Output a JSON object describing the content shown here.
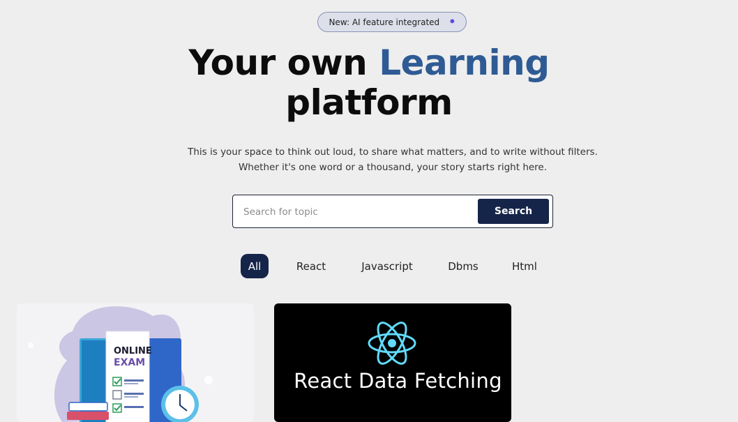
{
  "badge": {
    "text": "New: AI feature integrated",
    "icon": "sparkle-icon"
  },
  "hero": {
    "line1_prefix": "Your own ",
    "line1_accent": "Learning",
    "line2": "platform"
  },
  "description": "This is your space to think out loud, to share what matters, and to write without filters. Whether it's one word or a thousand, your story starts right here.",
  "search": {
    "placeholder": "Search for topic",
    "value": "",
    "button_label": "Search"
  },
  "filters": [
    {
      "label": "All",
      "active": true
    },
    {
      "label": "React",
      "active": false
    },
    {
      "label": "Javascript",
      "active": false
    },
    {
      "label": "Dbms",
      "active": false
    },
    {
      "label": "Html",
      "active": false
    }
  ],
  "cards": [
    {
      "image_text_line1": "ONLINE",
      "image_text_line2": "EXAM"
    },
    {
      "image_title": "React Data Fetching",
      "icon": "react-logo-icon"
    }
  ],
  "colors": {
    "accent": "#2f5b94",
    "navy": "#152449",
    "background": "#eeeeee",
    "badge_bg": "#dde0ea"
  }
}
